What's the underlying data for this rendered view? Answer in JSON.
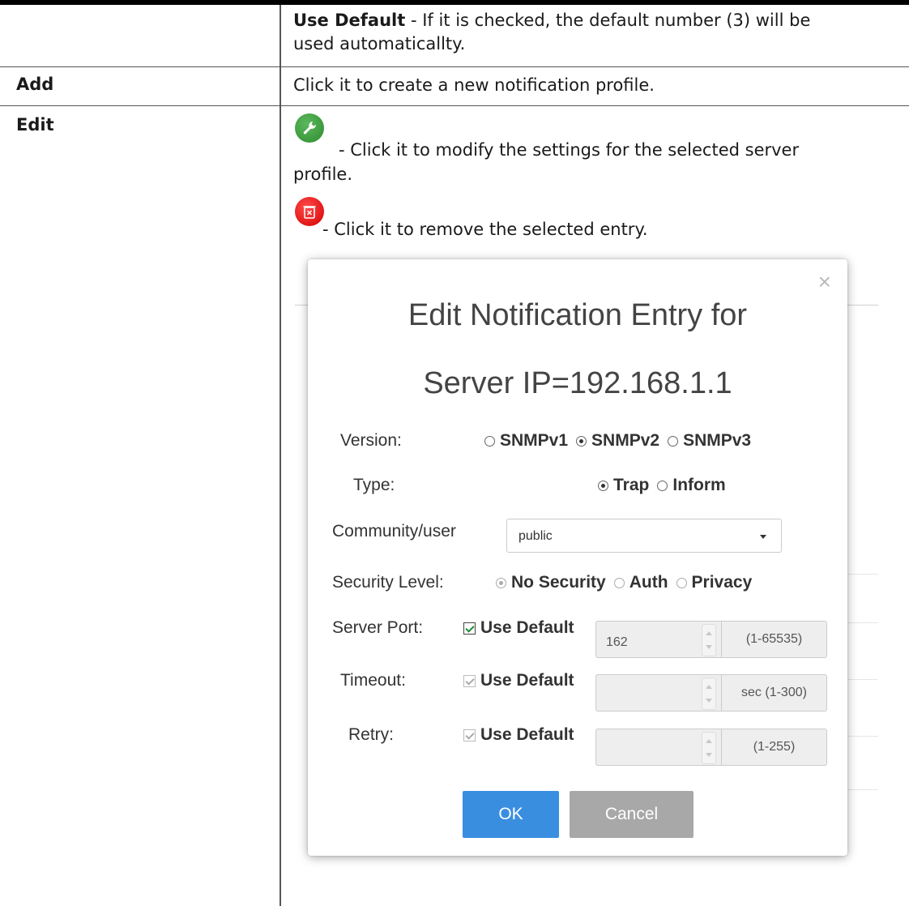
{
  "rows": {
    "use_default": {
      "label_bold": "Use Default",
      "desc_line1": " - If it is checked, the default number (3) will be",
      "desc_line2": "used automaticallty."
    },
    "add": {
      "label": "Add",
      "desc": "Click it to create a new notification profile."
    },
    "edit": {
      "label": "Edit",
      "modify_icon": "wrench-icon",
      "modify_line1": "- Click it to modify the settings for the selected server",
      "modify_line2": "profile.",
      "remove_icon": "trash-icon",
      "remove_text": "- Click it to remove the selected entry."
    }
  },
  "dialog": {
    "close": "×",
    "title_line1": "Edit Notification Entry for",
    "title_line2": "Server IP=192.168.1.1",
    "version": {
      "label": "Version:",
      "options": [
        "SNMPv1",
        "SNMPv2",
        "SNMPv3"
      ],
      "selected": "SNMPv2"
    },
    "type": {
      "label": "Type:",
      "options": [
        "Trap",
        "Inform"
      ],
      "selected": "Trap"
    },
    "community": {
      "label": "Community/user",
      "value": "public"
    },
    "security": {
      "label": "Security Level:",
      "options": [
        "No Security",
        "Auth",
        "Privacy"
      ],
      "selected": "No Security"
    },
    "server_port": {
      "label": "Server Port:",
      "checkbox": "Use Default",
      "value": "162",
      "range": "(1-65535)"
    },
    "timeout": {
      "label": "Timeout:",
      "checkbox": "Use Default",
      "value": "",
      "range": "sec (1-300)"
    },
    "retry": {
      "label": "Retry:",
      "checkbox": "Use Default",
      "value": "",
      "range": "(1-255)"
    },
    "ok_label": "OK",
    "cancel_label": "Cancel"
  },
  "colors": {
    "modify_icon_bg": "#3c9e3c",
    "remove_icon_bg": "#e60000",
    "ok_button": "#3a8ee0",
    "cancel_button": "#a8a8a8"
  }
}
